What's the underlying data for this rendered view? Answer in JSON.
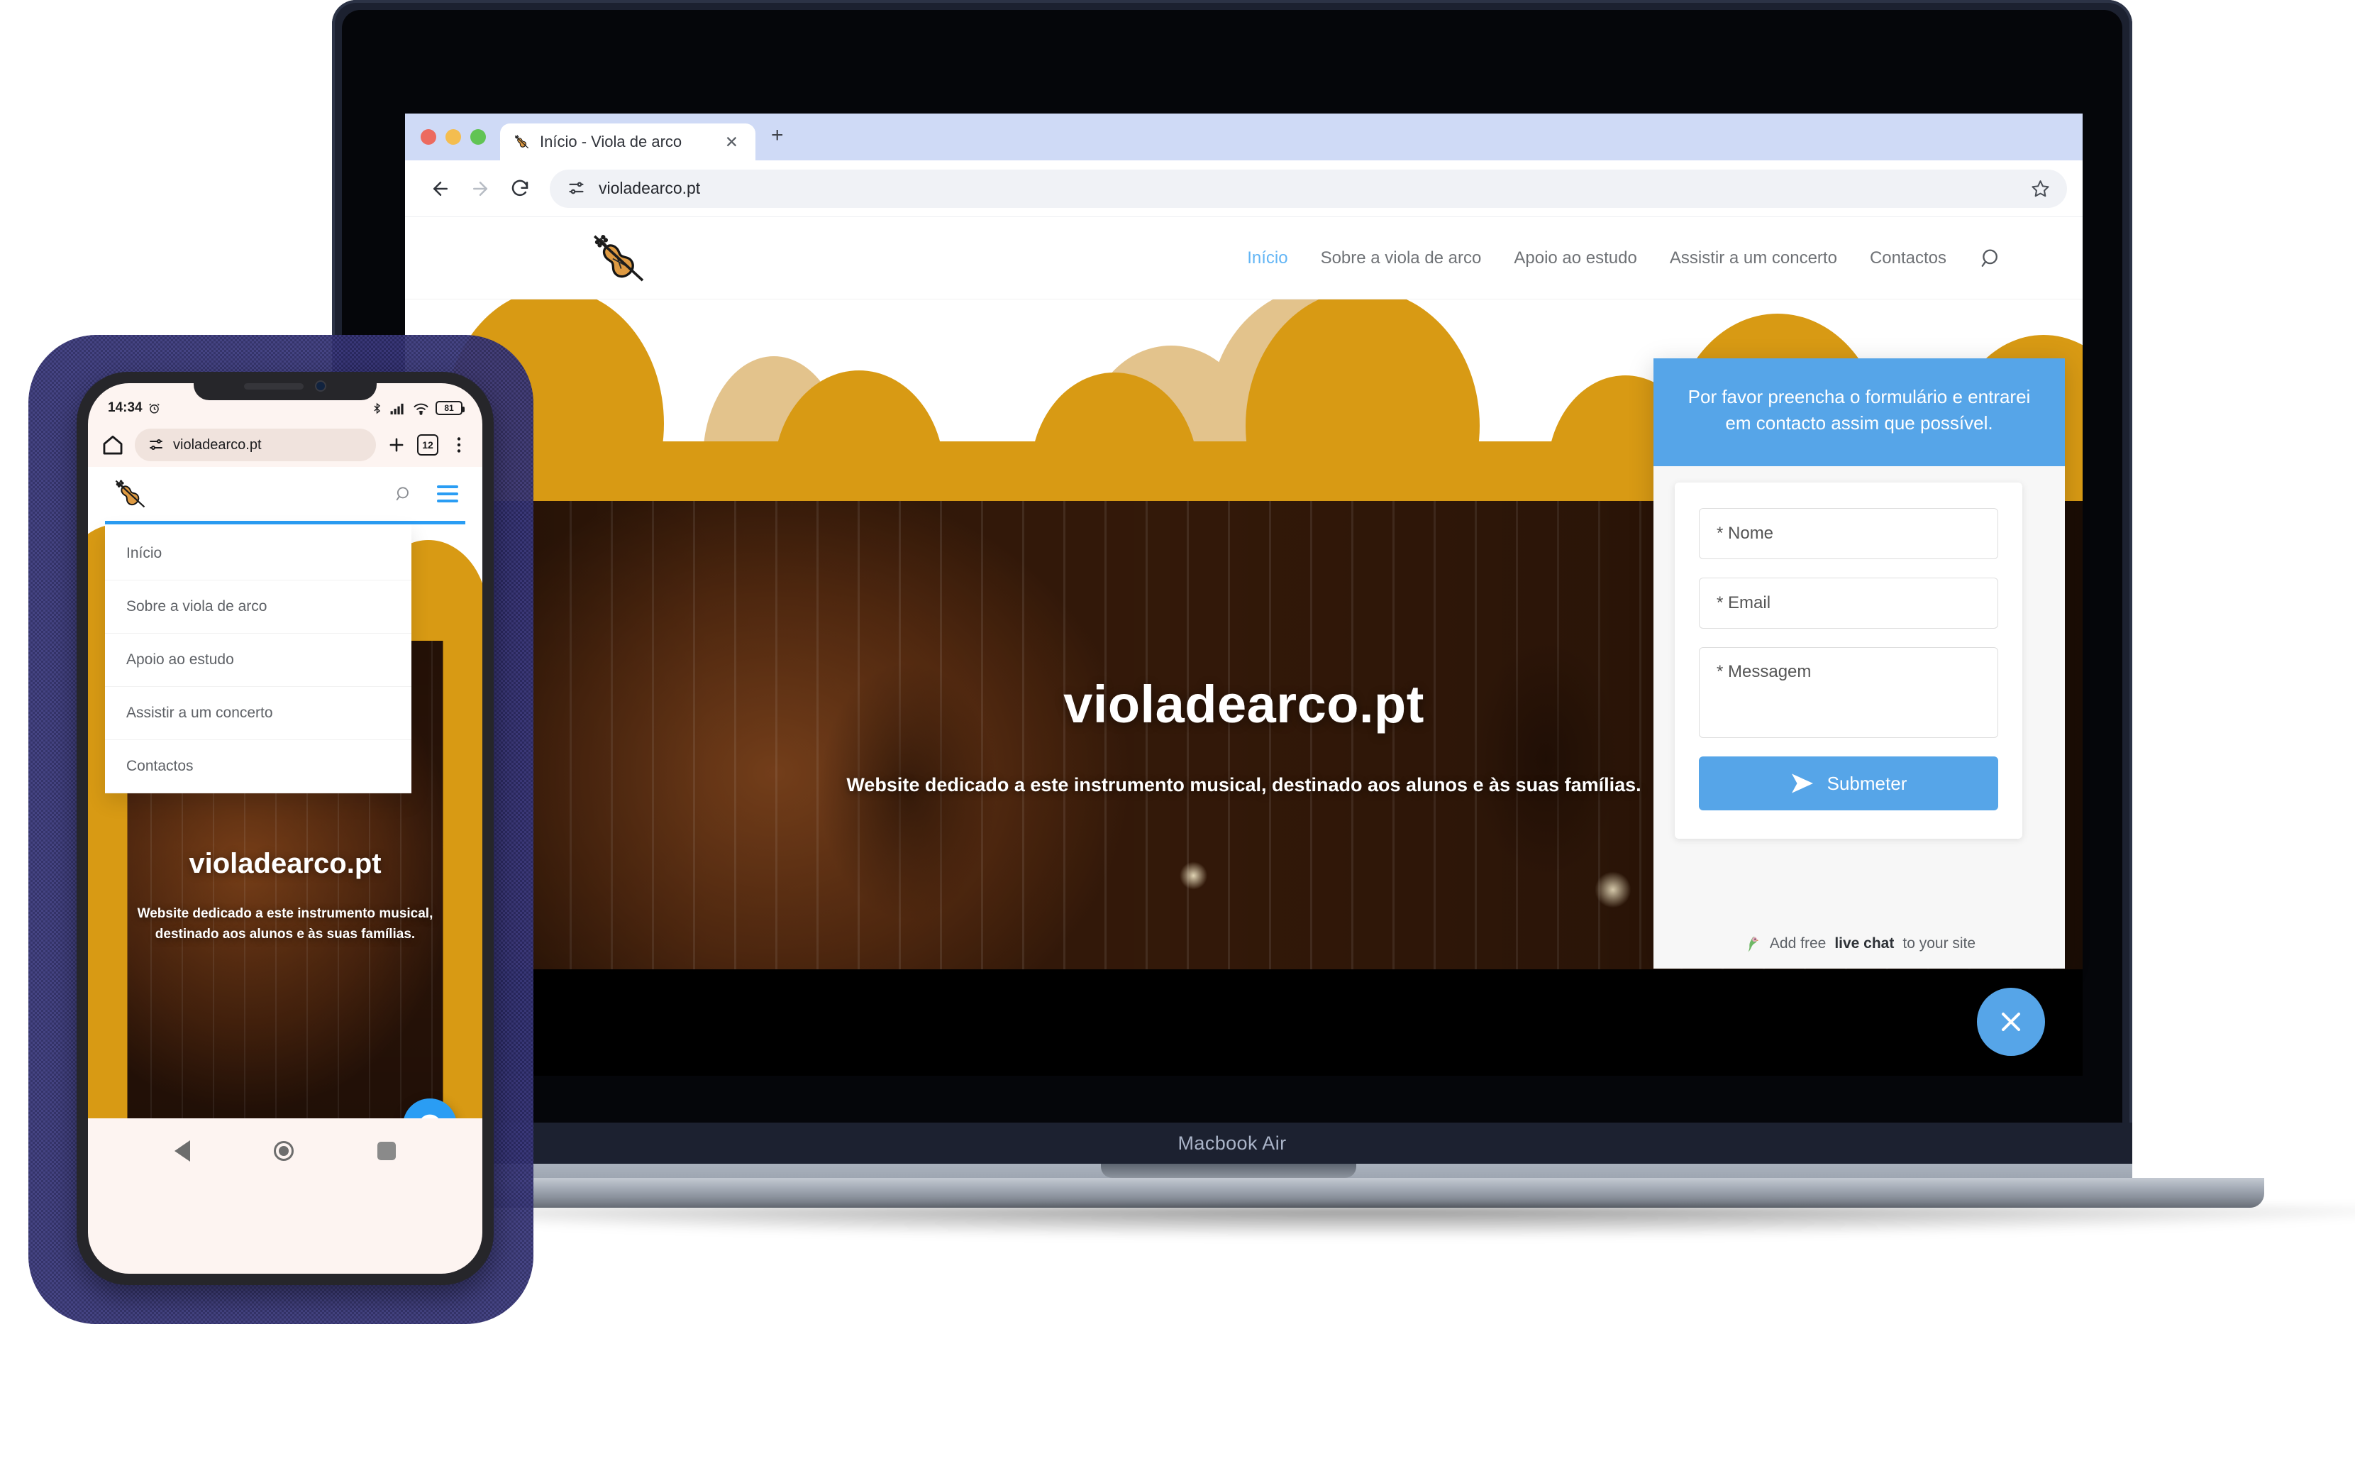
{
  "device_labels": {
    "laptop": "Macbook Air"
  },
  "browser": {
    "tab": {
      "title": "Início - Viola de arco",
      "favicon": "violin-icon",
      "close": "✕",
      "new_tab": "+"
    },
    "toolbar": {
      "back": "←",
      "forward": "→",
      "reload": "⟳",
      "url": "violadearco.pt",
      "site_info_icon": "tune-icon",
      "bookmark_icon": "star-icon"
    }
  },
  "site": {
    "logo": "violin-bow-icon",
    "nav": [
      {
        "label": "Início",
        "active": true
      },
      {
        "label": "Sobre a viola de arco",
        "active": false
      },
      {
        "label": "Apoio ao estudo",
        "active": false
      },
      {
        "label": "Assistir a um concerto",
        "active": false
      },
      {
        "label": "Contactos",
        "active": false
      }
    ],
    "search_icon": "search-icon",
    "hero": {
      "title": "violadearco.pt",
      "subtitle": "Website dedicado a este instrumento musical, destinado aos alunos e às suas famílias."
    },
    "colors": {
      "accent_orange": "#d89a14",
      "accent_orange_light": "#e3c38c",
      "link_blue": "#62b5f5"
    }
  },
  "chat_widget": {
    "header": "Por favor preencha o formulário e entrarei em contacto assim que possível.",
    "fields": [
      {
        "name": "nome",
        "placeholder": "* Nome",
        "value": ""
      },
      {
        "name": "email",
        "placeholder": "* Email",
        "value": ""
      },
      {
        "name": "messagem",
        "placeholder": "* Messagem",
        "value": ""
      }
    ],
    "submit_label": "Submeter",
    "submit_icon": "send-icon",
    "branding": {
      "prefix": "Add free ",
      "bold": "live chat",
      "suffix": " to your site",
      "icon": "parrot-icon"
    },
    "close_icon": "close-icon",
    "color": "#56a5e8"
  },
  "phone": {
    "status_bar": {
      "time": "14:34",
      "alarm_icon": "alarm-icon",
      "bluetooth_icon": "bluetooth-icon",
      "signal_icon": "signal-icon",
      "wifi_icon": "wifi-icon",
      "battery_level": "81"
    },
    "omnibar": {
      "home_icon": "home-icon",
      "site_info_icon": "tune-icon",
      "url": "violadearco.pt",
      "new_tab_icon": "plus-icon",
      "tab_count": "12",
      "menu_icon": "more-vertical-icon"
    },
    "site_header": {
      "logo": "violin-bow-icon",
      "search_icon": "search-icon",
      "menu_icon": "hamburger-icon"
    },
    "menu_items": [
      {
        "label": "Início"
      },
      {
        "label": "Sobre a viola de arco"
      },
      {
        "label": "Apoio ao estudo"
      },
      {
        "label": "Assistir a um concerto"
      },
      {
        "label": "Contactos"
      }
    ],
    "hero": {
      "title": "violadearco.pt",
      "subtitle": "Website dedicado a este instrumento musical, destinado aos alunos e às suas famílias."
    },
    "chat_bubble_icon": "chat-bubble-icon",
    "nav_bar": {
      "back_icon": "back-triangle-icon",
      "home_icon": "home-circle-icon",
      "recents_icon": "recents-square-icon"
    }
  }
}
